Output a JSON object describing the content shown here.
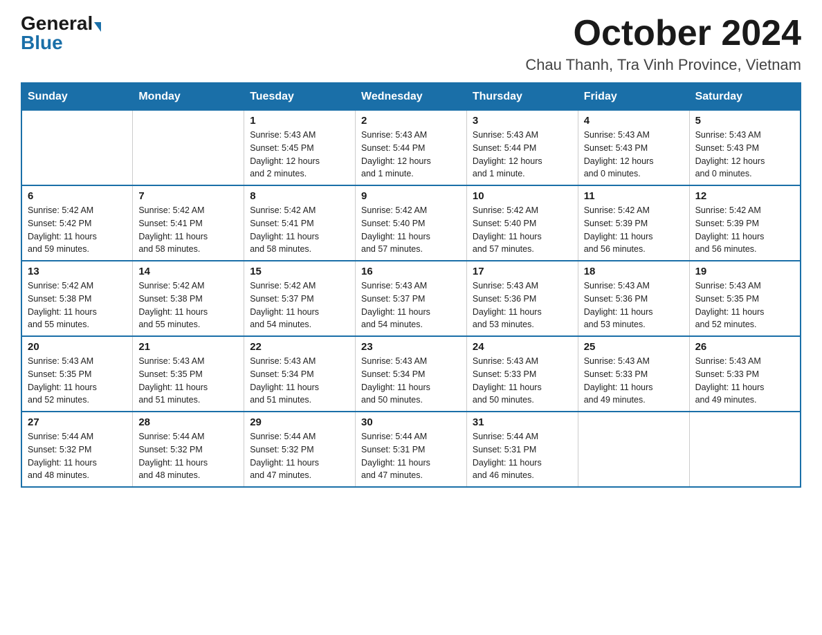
{
  "logo": {
    "general": "General",
    "blue": "Blue"
  },
  "header": {
    "month": "October 2024",
    "location": "Chau Thanh, Tra Vinh Province, Vietnam"
  },
  "calendar": {
    "days_of_week": [
      "Sunday",
      "Monday",
      "Tuesday",
      "Wednesday",
      "Thursday",
      "Friday",
      "Saturday"
    ],
    "weeks": [
      [
        {
          "day": "",
          "info": ""
        },
        {
          "day": "",
          "info": ""
        },
        {
          "day": "1",
          "info": "Sunrise: 5:43 AM\nSunset: 5:45 PM\nDaylight: 12 hours\nand 2 minutes."
        },
        {
          "day": "2",
          "info": "Sunrise: 5:43 AM\nSunset: 5:44 PM\nDaylight: 12 hours\nand 1 minute."
        },
        {
          "day": "3",
          "info": "Sunrise: 5:43 AM\nSunset: 5:44 PM\nDaylight: 12 hours\nand 1 minute."
        },
        {
          "day": "4",
          "info": "Sunrise: 5:43 AM\nSunset: 5:43 PM\nDaylight: 12 hours\nand 0 minutes."
        },
        {
          "day": "5",
          "info": "Sunrise: 5:43 AM\nSunset: 5:43 PM\nDaylight: 12 hours\nand 0 minutes."
        }
      ],
      [
        {
          "day": "6",
          "info": "Sunrise: 5:42 AM\nSunset: 5:42 PM\nDaylight: 11 hours\nand 59 minutes."
        },
        {
          "day": "7",
          "info": "Sunrise: 5:42 AM\nSunset: 5:41 PM\nDaylight: 11 hours\nand 58 minutes."
        },
        {
          "day": "8",
          "info": "Sunrise: 5:42 AM\nSunset: 5:41 PM\nDaylight: 11 hours\nand 58 minutes."
        },
        {
          "day": "9",
          "info": "Sunrise: 5:42 AM\nSunset: 5:40 PM\nDaylight: 11 hours\nand 57 minutes."
        },
        {
          "day": "10",
          "info": "Sunrise: 5:42 AM\nSunset: 5:40 PM\nDaylight: 11 hours\nand 57 minutes."
        },
        {
          "day": "11",
          "info": "Sunrise: 5:42 AM\nSunset: 5:39 PM\nDaylight: 11 hours\nand 56 minutes."
        },
        {
          "day": "12",
          "info": "Sunrise: 5:42 AM\nSunset: 5:39 PM\nDaylight: 11 hours\nand 56 minutes."
        }
      ],
      [
        {
          "day": "13",
          "info": "Sunrise: 5:42 AM\nSunset: 5:38 PM\nDaylight: 11 hours\nand 55 minutes."
        },
        {
          "day": "14",
          "info": "Sunrise: 5:42 AM\nSunset: 5:38 PM\nDaylight: 11 hours\nand 55 minutes."
        },
        {
          "day": "15",
          "info": "Sunrise: 5:42 AM\nSunset: 5:37 PM\nDaylight: 11 hours\nand 54 minutes."
        },
        {
          "day": "16",
          "info": "Sunrise: 5:43 AM\nSunset: 5:37 PM\nDaylight: 11 hours\nand 54 minutes."
        },
        {
          "day": "17",
          "info": "Sunrise: 5:43 AM\nSunset: 5:36 PM\nDaylight: 11 hours\nand 53 minutes."
        },
        {
          "day": "18",
          "info": "Sunrise: 5:43 AM\nSunset: 5:36 PM\nDaylight: 11 hours\nand 53 minutes."
        },
        {
          "day": "19",
          "info": "Sunrise: 5:43 AM\nSunset: 5:35 PM\nDaylight: 11 hours\nand 52 minutes."
        }
      ],
      [
        {
          "day": "20",
          "info": "Sunrise: 5:43 AM\nSunset: 5:35 PM\nDaylight: 11 hours\nand 52 minutes."
        },
        {
          "day": "21",
          "info": "Sunrise: 5:43 AM\nSunset: 5:35 PM\nDaylight: 11 hours\nand 51 minutes."
        },
        {
          "day": "22",
          "info": "Sunrise: 5:43 AM\nSunset: 5:34 PM\nDaylight: 11 hours\nand 51 minutes."
        },
        {
          "day": "23",
          "info": "Sunrise: 5:43 AM\nSunset: 5:34 PM\nDaylight: 11 hours\nand 50 minutes."
        },
        {
          "day": "24",
          "info": "Sunrise: 5:43 AM\nSunset: 5:33 PM\nDaylight: 11 hours\nand 50 minutes."
        },
        {
          "day": "25",
          "info": "Sunrise: 5:43 AM\nSunset: 5:33 PM\nDaylight: 11 hours\nand 49 minutes."
        },
        {
          "day": "26",
          "info": "Sunrise: 5:43 AM\nSunset: 5:33 PM\nDaylight: 11 hours\nand 49 minutes."
        }
      ],
      [
        {
          "day": "27",
          "info": "Sunrise: 5:44 AM\nSunset: 5:32 PM\nDaylight: 11 hours\nand 48 minutes."
        },
        {
          "day": "28",
          "info": "Sunrise: 5:44 AM\nSunset: 5:32 PM\nDaylight: 11 hours\nand 48 minutes."
        },
        {
          "day": "29",
          "info": "Sunrise: 5:44 AM\nSunset: 5:32 PM\nDaylight: 11 hours\nand 47 minutes."
        },
        {
          "day": "30",
          "info": "Sunrise: 5:44 AM\nSunset: 5:31 PM\nDaylight: 11 hours\nand 47 minutes."
        },
        {
          "day": "31",
          "info": "Sunrise: 5:44 AM\nSunset: 5:31 PM\nDaylight: 11 hours\nand 46 minutes."
        },
        {
          "day": "",
          "info": ""
        },
        {
          "day": "",
          "info": ""
        }
      ]
    ]
  }
}
